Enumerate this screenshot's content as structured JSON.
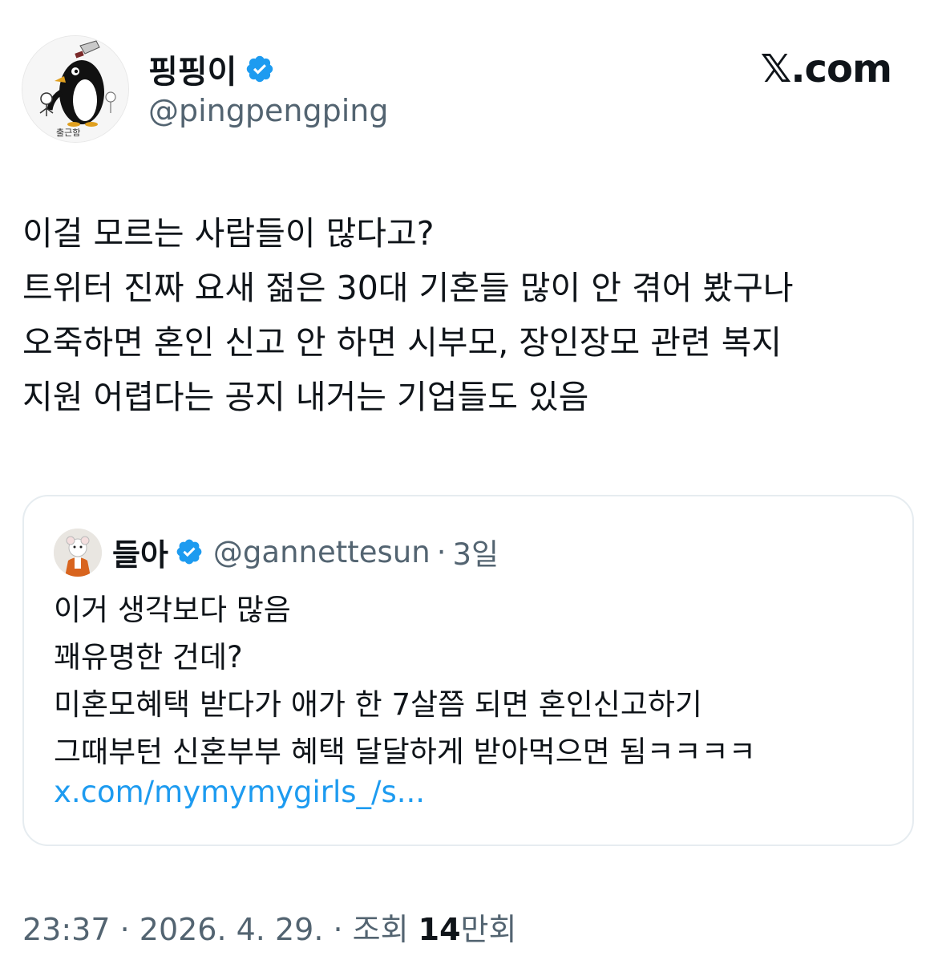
{
  "author": {
    "display_name": "핑핑이",
    "handle": "@pingpengping",
    "avatar_icon": "penguin-avatar-icon",
    "avatar_caption": "출근함",
    "verified": true
  },
  "brand": {
    "logo_text": "𝕏.com"
  },
  "tweet": {
    "lines": [
      "이걸 모르는 사람들이 많다고?",
      "트위터 진짜 요새 젊은 30대 기혼들 많이 안 겪어 봤구나",
      "오죽하면 혼인 신고 안 하면 시부모, 장인장모 관련 복지",
      "지원 어렵다는 공지 내거는 기업들도 있음"
    ]
  },
  "quoted": {
    "display_name": "들아",
    "handle": "@gannettesun",
    "separator": "·",
    "time": "3일",
    "avatar_icon": "mouse-avatar-icon",
    "verified": true,
    "lines": [
      "이거 생각보다 많음",
      "꽤유명한 건데?",
      "미혼모혜택 받다가 애가 한 7살쯤 되면 혼인신고하기",
      "그때부턴 신혼부부 혜택 달달하게 받아먹으면 됨ㅋㅋㅋㅋ"
    ],
    "link": "x.com/mymymygirls_/s..."
  },
  "footer": {
    "time": "23:37",
    "sep1": " · ",
    "date": "2026. 4. 29.",
    "sep2": " · ",
    "views_label": "조회 ",
    "views_count": "14",
    "views_unit": "만회"
  },
  "colors": {
    "text": "#0f1419",
    "secondary": "#536471",
    "verified_blue": "#1d9bf0",
    "link": "#1d9bf0",
    "border": "#e6ecf0"
  }
}
